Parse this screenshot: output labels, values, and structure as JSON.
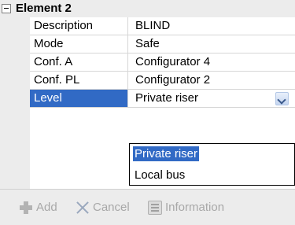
{
  "category": {
    "title": "Element 2"
  },
  "rows": [
    {
      "label": "Description",
      "value": "BLIND"
    },
    {
      "label": "Mode",
      "value": "Safe"
    },
    {
      "label": "Conf. A",
      "value": "Configurator 4"
    },
    {
      "label": "Conf. PL",
      "value": "Configurator 2"
    },
    {
      "label": "Level",
      "value": "Private riser"
    }
  ],
  "dropdown": {
    "options": [
      "Private riser",
      "Local bus"
    ],
    "selected": "Private riser"
  },
  "toolbar": {
    "add_label": "Add",
    "cancel_label": "Cancel",
    "information_label": "Information"
  },
  "icons": {
    "collapse": "minus-box-icon",
    "combo": "chevron-down-icon",
    "add": "plus-icon",
    "cancel": "x-icon",
    "information": "information-icon"
  },
  "colors": {
    "selection": "#316ac5",
    "gutter": "#ececec",
    "disabled_text": "#a8a8a8"
  }
}
